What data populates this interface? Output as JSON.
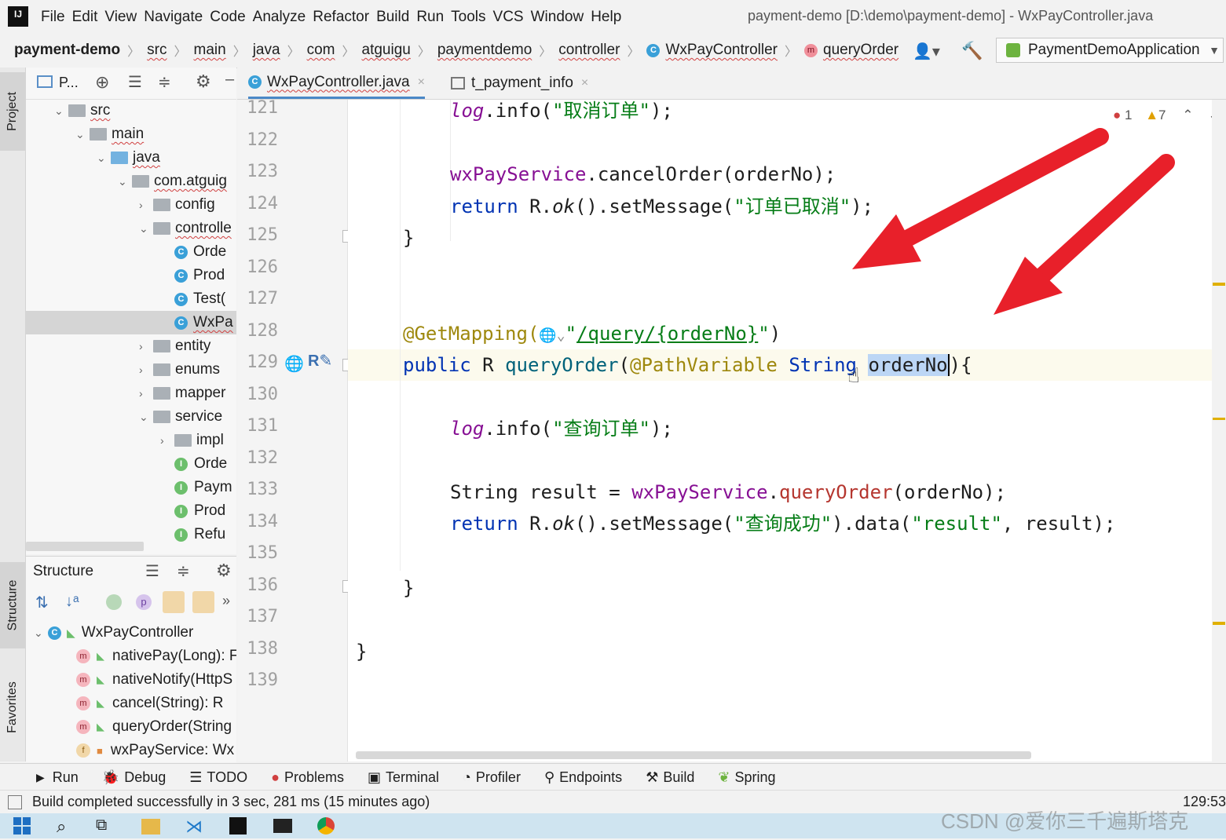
{
  "app": {
    "logo": "IJ",
    "title": "payment-demo [D:\\demo\\payment-demo] - WxPayController.java"
  },
  "menu": [
    "File",
    "Edit",
    "View",
    "Navigate",
    "Code",
    "Analyze",
    "Refactor",
    "Build",
    "Run",
    "Tools",
    "VCS",
    "Window",
    "Help"
  ],
  "breadcrumbs": [
    "payment-demo",
    "src",
    "main",
    "java",
    "com",
    "atguigu",
    "paymentdemo",
    "controller",
    "WxPayController",
    "queryOrder"
  ],
  "run_config": "PaymentDemoApplication",
  "left_tabs": {
    "project": "Project",
    "structure": "Structure",
    "favorites": "Favorites"
  },
  "project": {
    "toolbar_label": "P...",
    "tree": [
      {
        "label": "src",
        "type": "folder",
        "expanded": true
      },
      {
        "label": "main",
        "type": "folder",
        "expanded": true
      },
      {
        "label": "java",
        "type": "folder-blue",
        "expanded": true
      },
      {
        "label": "com.atguig",
        "type": "package",
        "expanded": true
      },
      {
        "label": "config",
        "type": "package",
        "expanded": false
      },
      {
        "label": "controlle",
        "type": "package",
        "expanded": true
      },
      {
        "label": "Orde",
        "type": "class"
      },
      {
        "label": "Prod",
        "type": "class"
      },
      {
        "label": "Test(",
        "type": "class"
      },
      {
        "label": "WxPa",
        "type": "class",
        "selected": true
      },
      {
        "label": "entity",
        "type": "package",
        "expanded": false
      },
      {
        "label": "enums",
        "type": "package",
        "expanded": false
      },
      {
        "label": "mapper",
        "type": "package",
        "expanded": false
      },
      {
        "label": "service",
        "type": "package",
        "expanded": true
      },
      {
        "label": "impl",
        "type": "package",
        "expanded": false
      },
      {
        "label": "Orde",
        "type": "interface"
      },
      {
        "label": "Paym",
        "type": "interface"
      },
      {
        "label": "Prod",
        "type": "interface"
      },
      {
        "label": "Refu",
        "type": "interface"
      }
    ]
  },
  "structure": {
    "title": "Structure",
    "root": "WxPayController",
    "items": [
      {
        "label": "nativePay(Long): F",
        "kind": "m"
      },
      {
        "label": "nativeNotify(HttpS",
        "kind": "m"
      },
      {
        "label": "cancel(String): R",
        "kind": "m"
      },
      {
        "label": "queryOrder(String",
        "kind": "m"
      },
      {
        "label": "wxPayService: Wx",
        "kind": "f"
      }
    ]
  },
  "tabs": [
    {
      "label": "WxPayController.java",
      "active": true
    },
    {
      "label": "t_payment_info",
      "active": false
    }
  ],
  "inspections": {
    "errors": "1",
    "warnings": "7"
  },
  "line_numbers": [
    "121",
    "122",
    "123",
    "124",
    "125",
    "126",
    "127",
    "128",
    "129",
    "130",
    "131",
    "132",
    "133",
    "134",
    "135",
    "136",
    "137",
    "138",
    "139"
  ],
  "code": {
    "l121a": "log",
    ".": ".",
    "l121": {
      "obj": "log",
      "rest": ".info(",
      "str": "\"取消订单\"",
      "end": ");"
    },
    "l123": {
      "obj": "wxPayService",
      "rest": ".cancelOrder(orderNo);"
    },
    "l124": {
      "kw": "return",
      "rest": " R.",
      "ok": "ok",
      "rest2": "().setMessage(",
      "str": "\"订单已取消\"",
      "end": ");"
    },
    "l125": "}",
    "l128": {
      "ann": "@GetMapping(",
      "str1": "\"",
      "path": "/query/{orderNo}",
      "str2": "\"",
      ")": ")"
    },
    "l129": {
      "kw": "public",
      "rest": " R ",
      "fn": "queryOrder",
      "p1": "(",
      "ann": "@PathVariable",
      "sp": " ",
      "type": "String",
      "sp2": " ",
      "param": "orderNo",
      "end": "){"
    },
    "l131": {
      "obj": "log",
      "rest": ".info(",
      "str": "\"查询订单\"",
      "end": ");"
    },
    "l133": {
      "a": "String result = ",
      "obj": "wxPayService",
      "dot": ".",
      "m": "queryOrder",
      "b": "(orderNo);"
    },
    "l134": {
      "kw": "return",
      "rest": " R.",
      "ok": "ok",
      "rest2": "().setMessage(",
      "str": "\"查询成功\"",
      "rest3": ").data(",
      "str2": "\"result\"",
      "end": ", result);"
    },
    "l136": "}",
    "l138": "}"
  },
  "tool_windows": [
    "Run",
    "Debug",
    "TODO",
    "Problems",
    "Terminal",
    "Profiler",
    "Endpoints",
    "Build",
    "Spring"
  ],
  "status": {
    "message": "Build completed successfully in 3 sec, 281 ms (15 minutes ago)",
    "position": "129:53"
  },
  "watermark": "CSDN @爱你三千遍斯塔克",
  "colors": {
    "arrow": "#e8202a",
    "keyword": "#0033b3",
    "string": "#067d17",
    "annotation": "#9e880d",
    "field": "#871094"
  }
}
